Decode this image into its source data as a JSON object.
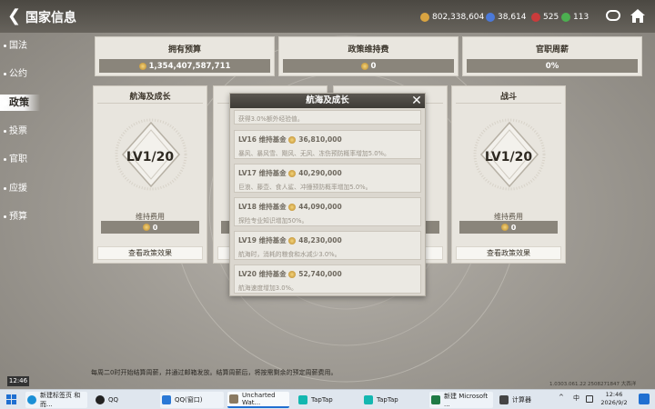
{
  "topbar": {
    "title": "国家信息",
    "resources": [
      {
        "icon": "gold-coin-icon",
        "value": "802,338,604",
        "color": "#d9a441"
      },
      {
        "icon": "gem-icon",
        "value": "38,614",
        "color": "#4b79d8"
      },
      {
        "icon": "ruby-icon",
        "value": "525",
        "color": "#c93b3b"
      },
      {
        "icon": "green-token-icon",
        "value": "113",
        "color": "#4caf50"
      }
    ]
  },
  "sidebar": {
    "items": [
      {
        "label": "国法"
      },
      {
        "label": "公约"
      },
      {
        "label": "政策"
      },
      {
        "label": "投票"
      },
      {
        "label": "官职"
      },
      {
        "label": "应援"
      },
      {
        "label": "预算"
      }
    ],
    "active_index": 2
  },
  "stats": [
    {
      "label": "拥有预算",
      "value": "1,354,407,587,711",
      "coin": true
    },
    {
      "label": "政策维持费",
      "value": "0",
      "coin": true
    },
    {
      "label": "官职周薪",
      "value": "0%",
      "coin": false
    }
  ],
  "cards": [
    {
      "title": "航海及成长",
      "level": "LV1/20",
      "fee_label": "维持费用",
      "fee_value": "0",
      "button": "查看政策效果"
    },
    {
      "title": "",
      "level": "",
      "fee_label": "",
      "fee_value": "",
      "button": ""
    },
    {
      "title": "",
      "level": "",
      "fee_label": "",
      "fee_value": "",
      "button": ""
    },
    {
      "title": "战斗",
      "level": "LV1/20",
      "fee_label": "维持费用",
      "fee_value": "0",
      "button": "查看政策效果"
    }
  ],
  "popup": {
    "title": "航海及成长",
    "top_partial_desc": "获得3.0%额外经验值。",
    "items": [
      {
        "level": "LV16",
        "fund_label": "维持基金",
        "amount": "36,810,000",
        "desc": "暴风、暴风雪、飓风、无风、冻伤预防概率增加5.0%。"
      },
      {
        "level": "LV17",
        "fund_label": "维持基金",
        "amount": "40,290,000",
        "desc": "巨浪、藤壶、食人鲨、冲撞预防概率增加5.0%。"
      },
      {
        "level": "LV18",
        "fund_label": "维持基金",
        "amount": "44,090,000",
        "desc": "探险专业知识增加50%。"
      },
      {
        "level": "LV19",
        "fund_label": "维持基金",
        "amount": "48,230,000",
        "desc": "航海时，消耗的粮食和水减少3.0%。"
      },
      {
        "level": "LV20",
        "fund_label": "维持基金",
        "amount": "52,740,000",
        "desc": "航海速度增加3.0%。"
      }
    ]
  },
  "footer": {
    "hint": "每周二0时开始结算周薪，并通过邮箱发放。结算周薪后，将按需剩余的预定周薪费用。",
    "time_badge": "12:46",
    "version": "1.0303.061.22 2508271847 大西洋"
  },
  "taskbar": {
    "items": [
      {
        "label": "新建标签页 和而...",
        "icon": "edge-icon",
        "color": "#1a8fd6"
      },
      {
        "label": "QQ",
        "icon": "qq-icon",
        "color": "#222222"
      },
      {
        "label": "QQ(窗口)",
        "icon": "qq-window-icon",
        "color": "#2b79d6"
      },
      {
        "label": "Uncharted Wat...",
        "icon": "game-icon",
        "color": "#8a7a62"
      },
      {
        "label": "TapTap",
        "icon": "taptap-icon",
        "color": "#13b7b0"
      },
      {
        "label": "TapTap",
        "icon": "taptap-icon",
        "color": "#13b7b0"
      },
      {
        "label": "新建 Microsoft ...",
        "icon": "excel-icon",
        "color": "#1f7a45"
      },
      {
        "label": "计算器",
        "icon": "calculator-icon",
        "color": "#444444"
      }
    ],
    "active_index": 3,
    "tray_chevron": "^",
    "ime": "中",
    "time": "12:46",
    "date": "2026/9/2"
  }
}
